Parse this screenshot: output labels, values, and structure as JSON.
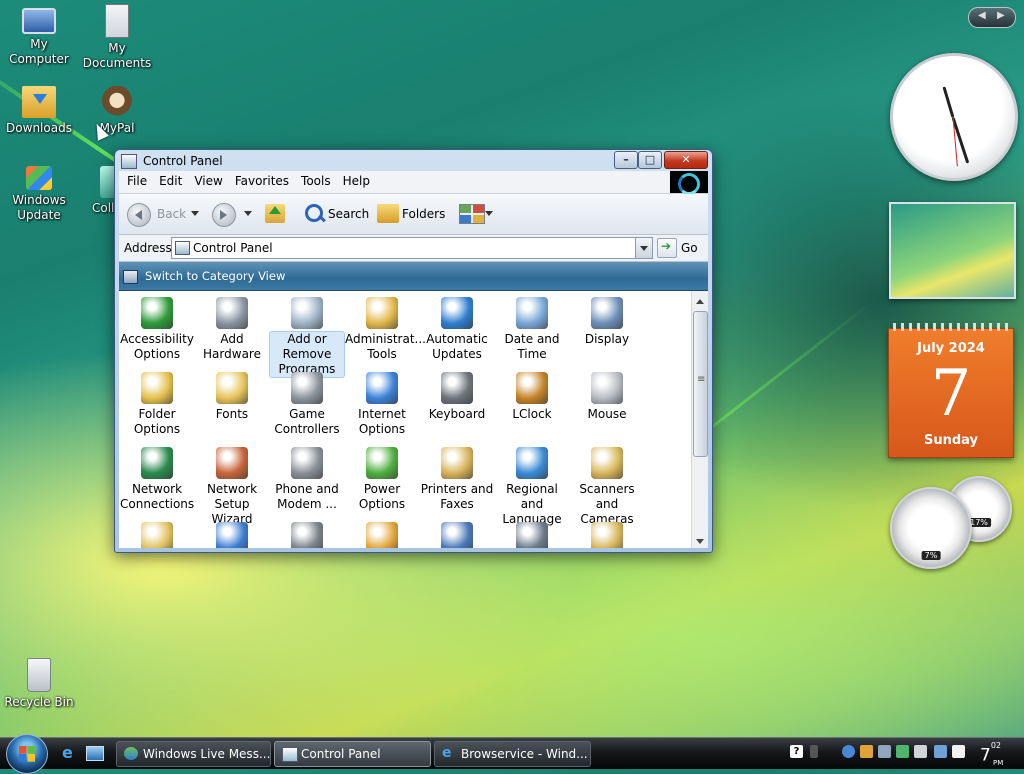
{
  "desktop": {
    "icons": [
      {
        "label": "My Computer",
        "icon": "computer-icon"
      },
      {
        "label": "My Documents",
        "icon": "documents-icon"
      },
      {
        "label": "Downloads",
        "icon": "downloads-folder-icon"
      },
      {
        "label": "MyPal",
        "icon": "mypal-browser-icon"
      },
      {
        "label": "Windows Update",
        "icon": "windows-update-icon"
      },
      {
        "label": "Coll",
        "icon": "collection-icon"
      },
      {
        "label": "Recycle Bin",
        "icon": "recycle-bin-icon"
      }
    ]
  },
  "window": {
    "title": "Control Panel",
    "menu": [
      "File",
      "Edit",
      "View",
      "Favorites",
      "Tools",
      "Help"
    ],
    "toolbar": {
      "back_label": "Back",
      "search_label": "Search",
      "folders_label": "Folders"
    },
    "address": {
      "label": "Address",
      "value": "Control Panel",
      "go_label": "Go"
    },
    "category_link": "Switch to Category View",
    "items": [
      {
        "label1": "Accessibility",
        "label2": "Options",
        "label3": "",
        "icon": "accessibility-icon",
        "color": "#2e9b3a"
      },
      {
        "label1": "Add",
        "label2": "Hardware",
        "label3": "",
        "icon": "hardware-icon",
        "color": "#8a96a3"
      },
      {
        "label1": "Add or",
        "label2": "Remove",
        "label3": "Programs",
        "icon": "programs-icon",
        "color": "#9fb3c7"
      },
      {
        "label1": "Administrat...",
        "label2": "Tools",
        "label3": "",
        "icon": "admin-tools-icon",
        "color": "#e2b84a"
      },
      {
        "label1": "Automatic",
        "label2": "Updates",
        "label3": "",
        "icon": "auto-updates-icon",
        "color": "#2f7fd0"
      },
      {
        "label1": "Date and",
        "label2": "Time",
        "label3": "",
        "icon": "date-time-icon",
        "color": "#7aa8d8"
      },
      {
        "label1": "Display",
        "label2": "",
        "label3": "",
        "icon": "display-icon",
        "color": "#6d8fb8"
      },
      {
        "label1": "Folder",
        "label2": "Options",
        "label3": "",
        "icon": "folder-options-icon",
        "color": "#e3c04e"
      },
      {
        "label1": "Fonts",
        "label2": "",
        "label3": "",
        "icon": "fonts-icon",
        "color": "#e6c35a"
      },
      {
        "label1": "Game",
        "label2": "Controllers",
        "label3": "",
        "icon": "game-controller-icon",
        "color": "#8b949d"
      },
      {
        "label1": "Internet",
        "label2": "Options",
        "label3": "",
        "icon": "internet-options-icon",
        "color": "#3b82d8"
      },
      {
        "label1": "Keyboard",
        "label2": "",
        "label3": "",
        "icon": "keyboard-icon",
        "color": "#6e747a"
      },
      {
        "label1": "LClock",
        "label2": "",
        "label3": "",
        "icon": "lclock-icon",
        "color": "#c4842a"
      },
      {
        "label1": "Mouse",
        "label2": "",
        "label3": "",
        "icon": "mouse-icon",
        "color": "#b7bcc2"
      },
      {
        "label1": "Network",
        "label2": "Connections",
        "label3": "",
        "icon": "network-connections-icon",
        "color": "#2a8a4e"
      },
      {
        "label1": "Network",
        "label2": "Setup Wizard",
        "label3": "",
        "icon": "network-wizard-icon",
        "color": "#c8643a"
      },
      {
        "label1": "Phone and",
        "label2": "Modem ...",
        "label3": "",
        "icon": "phone-modem-icon",
        "color": "#8a9098"
      },
      {
        "label1": "Power",
        "label2": "Options",
        "label3": "",
        "icon": "power-options-icon",
        "color": "#4fae3f"
      },
      {
        "label1": "Printers and",
        "label2": "Faxes",
        "label3": "",
        "icon": "printer-icon",
        "color": "#d8b35a"
      },
      {
        "label1": "Regional and",
        "label2": "Language ...",
        "label3": "",
        "icon": "regional-icon",
        "color": "#3a8ad6"
      },
      {
        "label1": "Scanners and",
        "label2": "Cameras",
        "label3": "",
        "icon": "scanner-camera-icon",
        "color": "#d9b75b"
      },
      {
        "label1": "",
        "label2": "",
        "label3": "",
        "icon": "scheduled-tasks-icon",
        "color": "#e0c25e"
      },
      {
        "label1": "",
        "label2": "",
        "label3": "",
        "icon": "security-center-icon",
        "color": "#3c7dd0"
      },
      {
        "label1": "",
        "label2": "",
        "label3": "",
        "icon": "sounds-icon",
        "color": "#7c828a"
      },
      {
        "label1": "",
        "label2": "",
        "label3": "",
        "icon": "speech-icon",
        "color": "#e2a63b"
      },
      {
        "label1": "",
        "label2": "",
        "label3": "",
        "icon": "system-icon",
        "color": "#4a78b8"
      },
      {
        "label1": "",
        "label2": "",
        "label3": "",
        "icon": "taskbar-icon",
        "color": "#6b7a8a"
      },
      {
        "label1": "",
        "label2": "",
        "label3": "",
        "icon": "user-accounts-icon",
        "color": "#d8b65a"
      }
    ]
  },
  "gadgets": {
    "calendar": {
      "month": "July 2024",
      "day": "7",
      "weekday": "Sunday"
    },
    "cpu_meter": {
      "cpu": "7%",
      "memory": "17%"
    },
    "clock": {
      "hour": 11,
      "minute": 27
    }
  },
  "taskbar": {
    "buttons": [
      {
        "label": "Windows Live Mess...",
        "icon": "messenger-icon"
      },
      {
        "label": "Control Panel",
        "icon": "control-panel-icon"
      },
      {
        "label": "Browservice - Wind...",
        "icon": "ie-icon"
      }
    ],
    "time": {
      "hour": "7",
      "minute": "02",
      "ampm": "PM"
    }
  },
  "colors": {
    "titlebar": "#cfe0f2",
    "category_bar": "#2d6a94",
    "calendar": "#e86a22",
    "close_button": "#c33a1f"
  }
}
